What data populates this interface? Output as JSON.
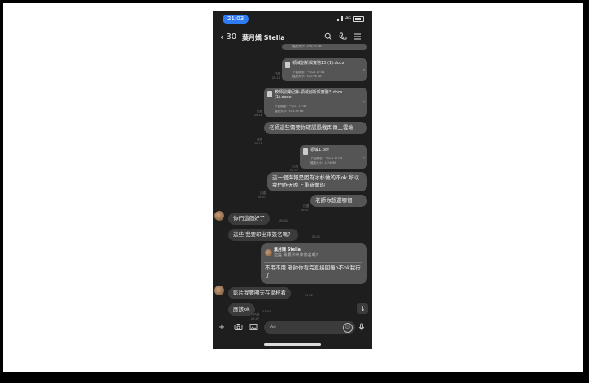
{
  "status_bar": {
    "time": "21:03",
    "network": "4G"
  },
  "header": {
    "back_count": "30",
    "title": "葉月嬌 Stella"
  },
  "messages": {
    "file0": {
      "meta_size": "檔案大小：290.93 KB"
    },
    "file1": {
      "meta_read": "已讀",
      "meta_time": "20:18",
      "name": "領域創新與實務13 (1).docx",
      "expiry": "下載期限：~6/21 17:44",
      "size": "檔案大小：412.96 KB"
    },
    "file2": {
      "meta_read": "已讀",
      "meta_time": "20:18",
      "name": "教師授課紀錄-領域創新與實務3.docx (1).docx",
      "expiry": "下載期限：~6/21 17:44",
      "size": "檔案大小：543.33 KB"
    },
    "text1": {
      "meta_read": "已讀",
      "meta_time": "20:18",
      "text": "老師這些需要你確認過我再傳上雲端"
    },
    "file3": {
      "meta_read": "已讀",
      "meta_time": "20:37",
      "name": "領域1.pdf",
      "expiry": "下載期限：~6/21 17:44",
      "size": "檔案大小：1.74 MB"
    },
    "text2": {
      "meta_read": "已讀",
      "meta_time": "20:37",
      "text": "這一個海報是因為冰杉做的不ok 所以我們昨天晚上重新做的"
    },
    "text3": {
      "meta_read": "已讀",
      "meta_time": "20:37",
      "text": "老師你想選哪個"
    },
    "in1": {
      "text": "你們這個好了",
      "time": "20:41"
    },
    "in2": {
      "text": "這些 我要印出來簽名嗎？",
      "time": "20:41"
    },
    "reply": {
      "quote_name": "葉月嬌 Stella",
      "quote_text": "這些 我要印出來簽名嗎？",
      "text": "不用不用 老師你看完直接回覆o不ok我行了",
      "meta_read": "已讀",
      "meta_time": "20:47"
    },
    "in3": {
      "text": "影片我要明天在學校看",
      "time": "21:02"
    },
    "in4": {
      "text": "應該ok",
      "time": "21:02"
    }
  },
  "input": {
    "placeholder": "Aa"
  },
  "colors": {
    "background": "#1e1e1e",
    "outgoing": "#555555",
    "incoming": "#3b3b3b",
    "time_pill": "#2f7cf6"
  }
}
